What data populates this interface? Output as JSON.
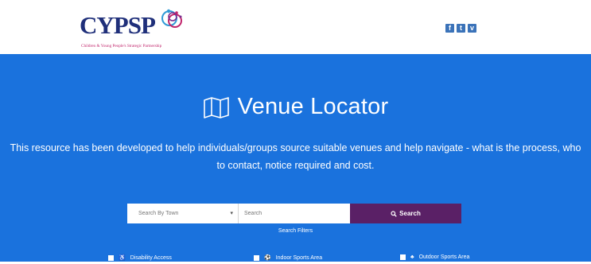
{
  "header": {
    "logo_text": "CYPSP",
    "logo_tagline": "Children & Young People's Strategic Partnership",
    "social": [
      {
        "icon": "facebook-icon",
        "glyph": "f"
      },
      {
        "icon": "twitter-icon",
        "glyph": "t"
      },
      {
        "icon": "vimeo-icon",
        "glyph": "v"
      }
    ]
  },
  "hero": {
    "title": "Venue Locator",
    "title_icon": "map-icon",
    "description": "This resource has been developed to help individuals/groups source suitable venues and help navigate - what is the process, who to contact, notice required and cost."
  },
  "search": {
    "town_placeholder": "Search By Town",
    "search_placeholder": "Search",
    "button_label": "Search",
    "filters_label": "Search Filters"
  },
  "filters": [
    {
      "label": "Disability Access",
      "icon": "accessibility-icon"
    },
    {
      "label": "Indoor Sports Area",
      "icon": "football-icon"
    },
    {
      "label": "Outdoor Sports Area",
      "icon": "tree-icon"
    }
  ],
  "colors": {
    "hero_bg": "#1a72dd",
    "button_bg": "#5a2066",
    "logo_navy": "#1f2f7a",
    "logo_pink": "#c0246b"
  }
}
